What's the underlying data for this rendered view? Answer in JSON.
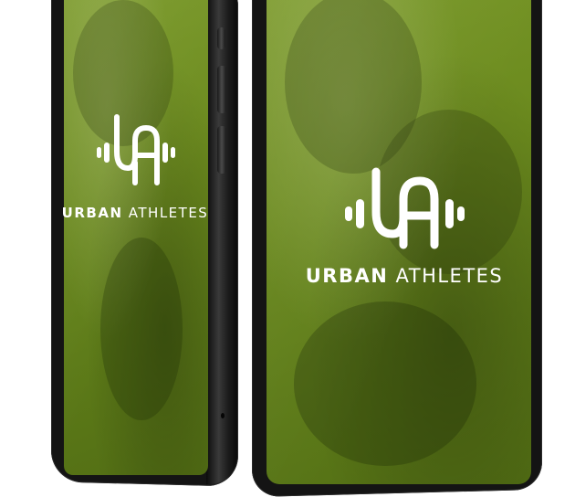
{
  "brand": {
    "name_bold": "URBAN",
    "name_light": "ATHLETES",
    "monogram": "UA",
    "accent_color": "#6b8a1e",
    "text_color": "#ffffff"
  },
  "devices": [
    {
      "id": "left",
      "description_icon": "phone-icon"
    },
    {
      "id": "right",
      "description_icon": "phone-icon"
    }
  ]
}
